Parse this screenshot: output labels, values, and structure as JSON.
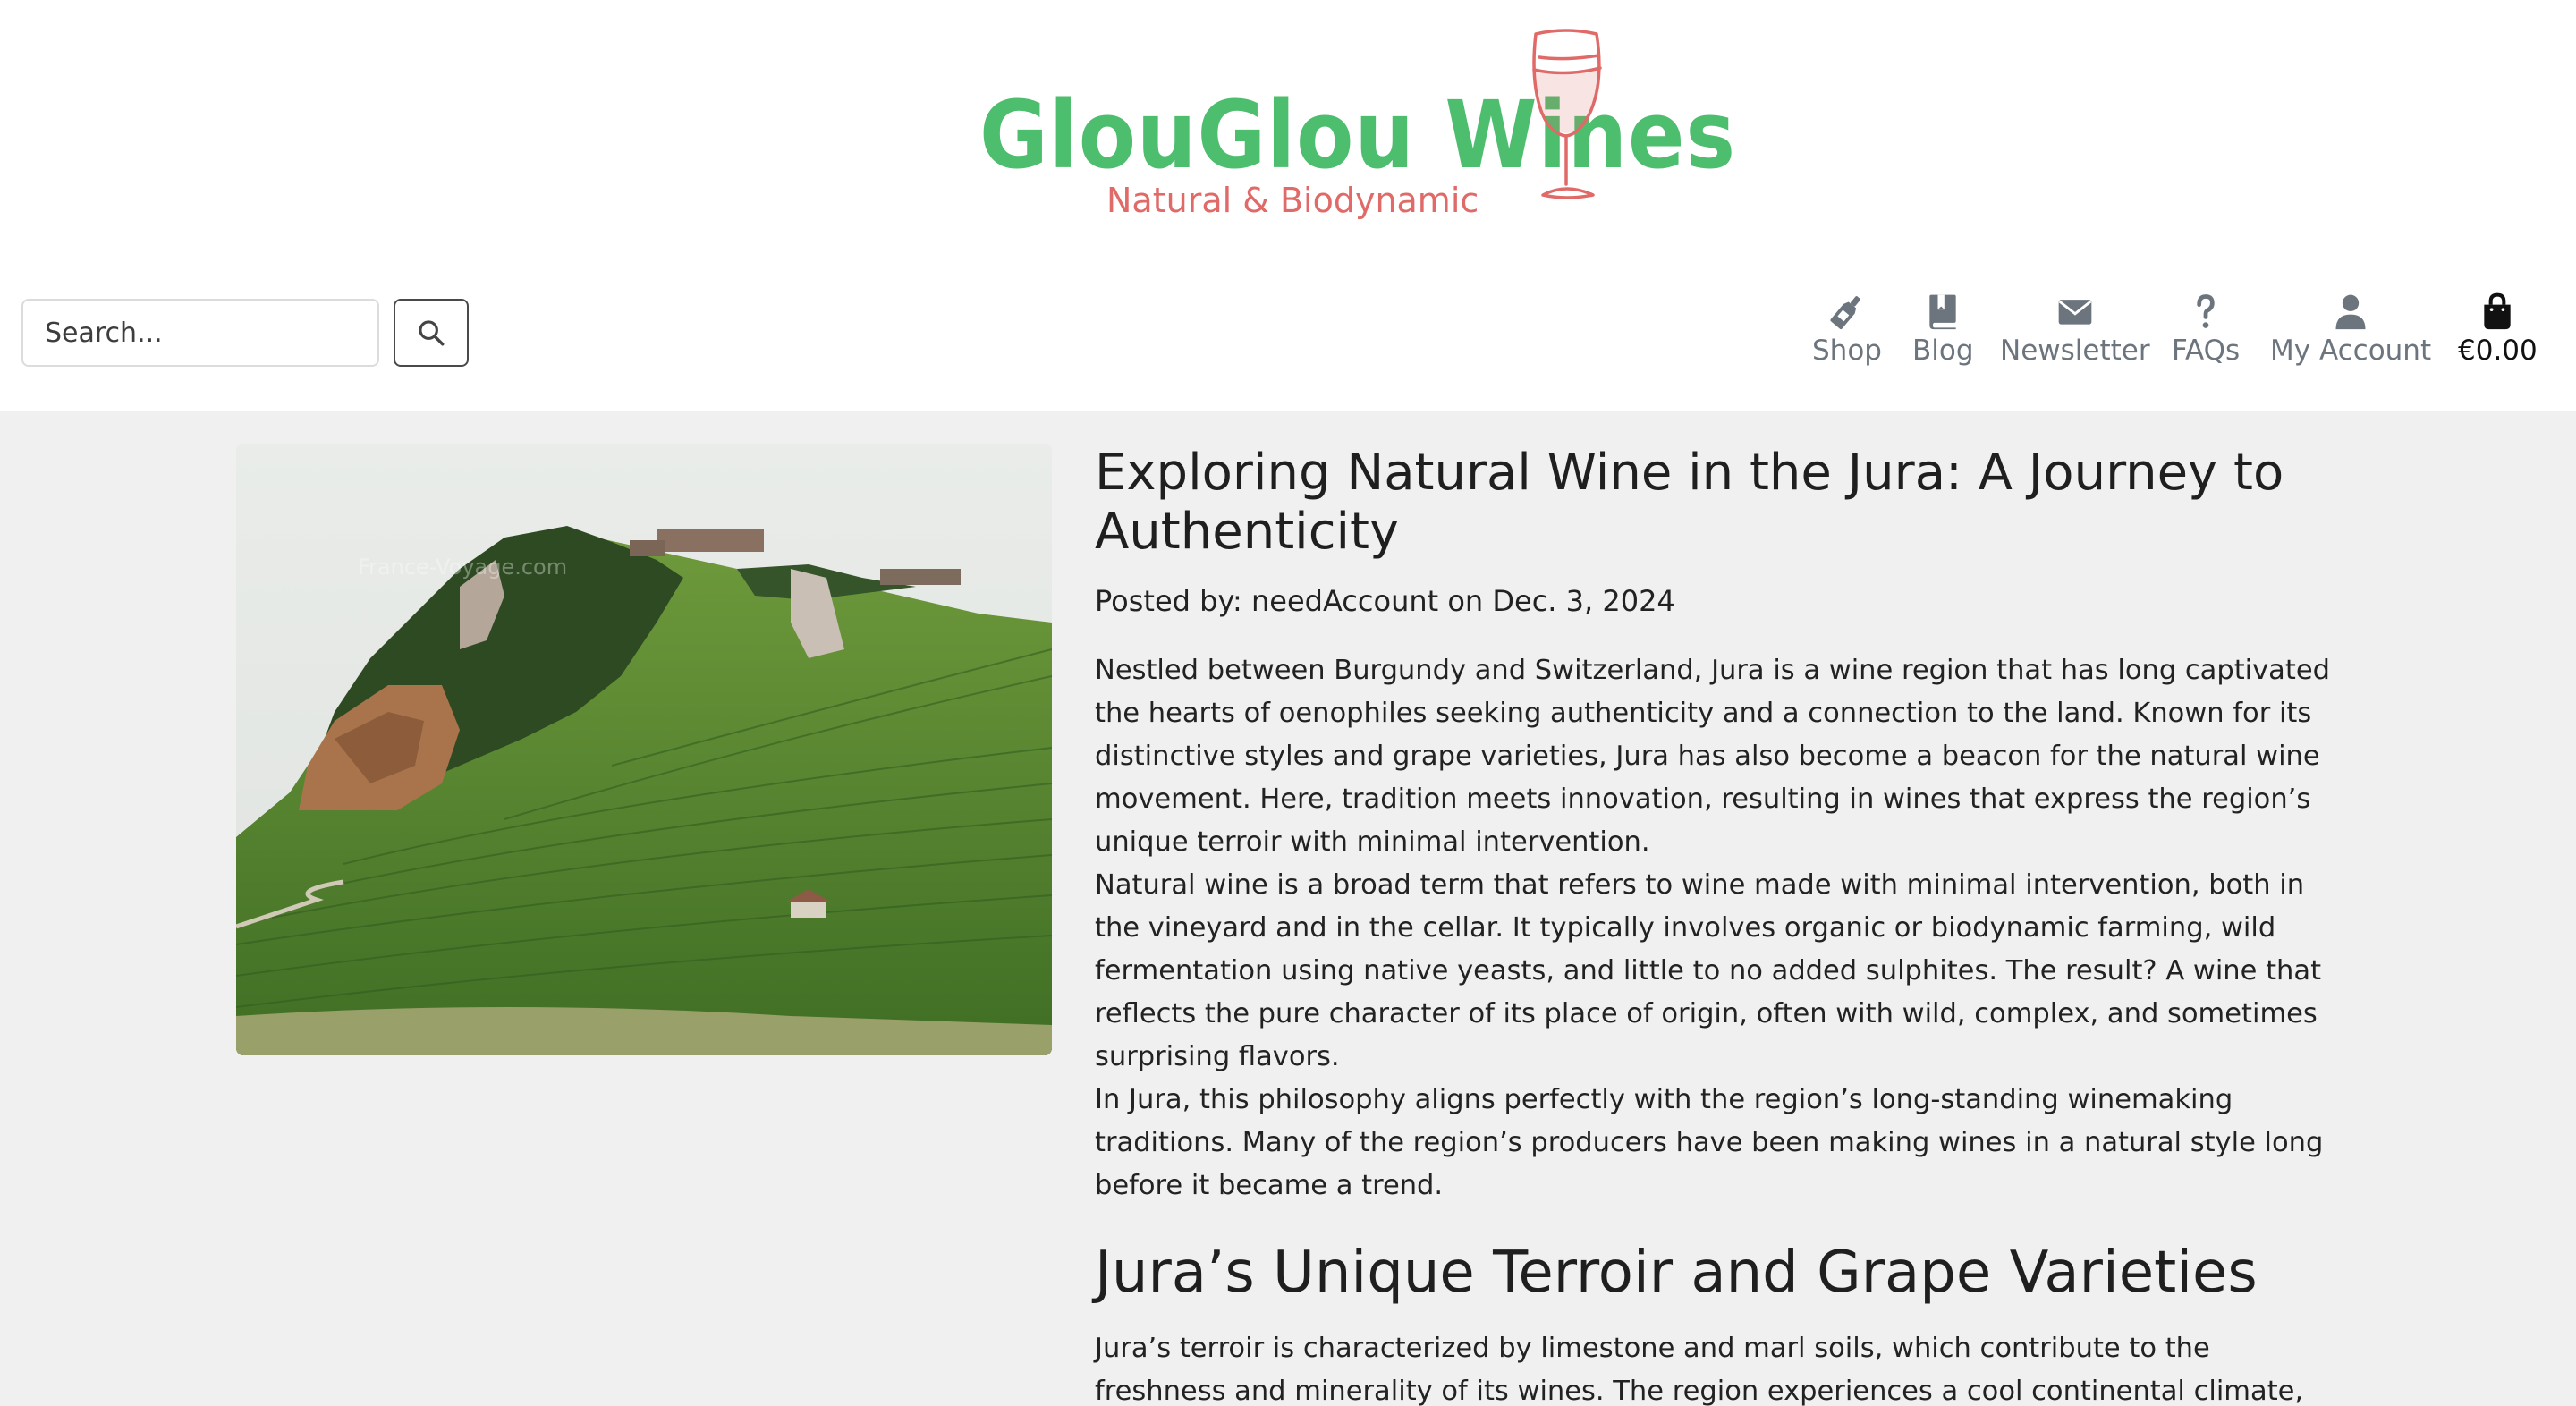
{
  "brand": {
    "name": "GlouGlou Wines",
    "tagline": "Natural & Biodynamic",
    "title_color": "#4dbd6e",
    "accent_color": "#e06a68"
  },
  "search": {
    "placeholder": "Search...",
    "button_icon": "magnifier-icon"
  },
  "nav": {
    "shop": {
      "label": "Shop",
      "icon": "wine-bottle-icon"
    },
    "blog": {
      "label": "Blog",
      "icon": "book-icon"
    },
    "newsletter": {
      "label": "Newsletter",
      "icon": "envelope-icon"
    },
    "faqs": {
      "label": "FAQs",
      "icon": "question-icon"
    },
    "account": {
      "label": "My Account",
      "icon": "user-icon"
    },
    "cart": {
      "label": "€0.00",
      "icon": "shopping-bag-icon"
    }
  },
  "article": {
    "title": "Exploring Natural Wine in the Jura: A Journey to Authenticity",
    "meta": "Posted by: needAccount on Dec. 3, 2024",
    "image_watermark": "France-Voyage.com",
    "paragraphs": [
      "Nestled between Burgundy and Switzerland, Jura is a wine region that has long captivated the hearts of oenophiles seeking authenticity and a connection to the land. Known for its distinctive styles and grape varieties, Jura has also become a beacon for the natural wine movement. Here, tradition meets innovation, resulting in wines that express the region’s unique terroir with minimal intervention.",
      "Natural wine is a broad term that refers to wine made with minimal intervention, both in the vineyard and in the cellar. It typically involves organic or biodynamic farming, wild fermentation using native yeasts, and little to no added sulphites. The result? A wine that reflects the pure character of its place of origin, often with wild, complex, and sometimes surprising flavors.",
      "In Jura, this philosophy aligns perfectly with the region’s long-standing winemaking traditions. Many of the region’s producers have been making wines in a natural style long before it became a trend."
    ],
    "section_heading": "Jura’s Unique Terroir and Grape Varieties",
    "section_paragraph": "Jura’s terroir is characterized by limestone and marl soils, which contribute to the freshness and minerality of its wines. The region experiences a cool continental climate, which helps"
  }
}
